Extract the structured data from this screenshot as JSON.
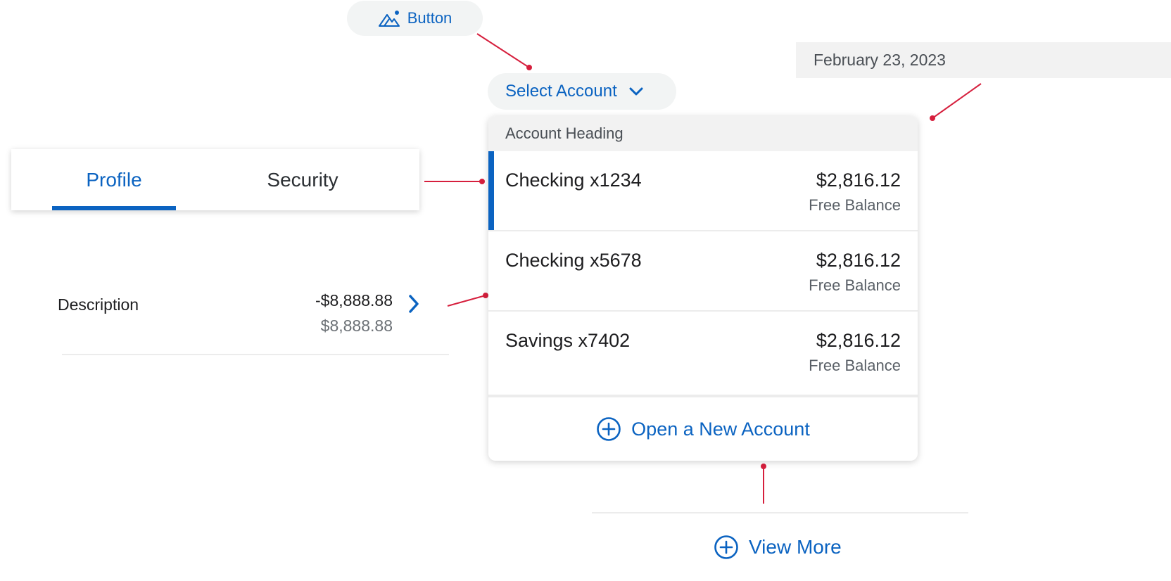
{
  "ghost_button": {
    "label": "Button",
    "icon": "mountain-person-icon"
  },
  "select_account": {
    "label": "Select Account",
    "icon": "chevron-down-icon"
  },
  "date_bar": {
    "text": "February 23, 2023"
  },
  "tabs": [
    {
      "label": "Profile",
      "active": true
    },
    {
      "label": "Security",
      "active": false
    }
  ],
  "description_row": {
    "label": "Description",
    "amount": "-$8,888.88",
    "sub_amount": "$8,888.88",
    "icon": "chevron-right-icon"
  },
  "dropdown": {
    "heading": "Account Heading",
    "items": [
      {
        "name": "Checking x1234",
        "amount": "$2,816.12",
        "sub": "Free Balance",
        "active": true
      },
      {
        "name": "Checking x5678",
        "amount": "$2,816.12",
        "sub": "Free Balance",
        "active": false
      },
      {
        "name": "Savings x7402",
        "amount": "$2,816.12",
        "sub": "Free Balance",
        "active": false
      }
    ],
    "open_account_label": "Open a New Account"
  },
  "view_more": {
    "label": "View More"
  },
  "colors": {
    "accent": "#0b63c1",
    "connector": "#d61f3d",
    "pill_bg": "#f2f4f4",
    "heading_bg": "#f2f2f2"
  }
}
